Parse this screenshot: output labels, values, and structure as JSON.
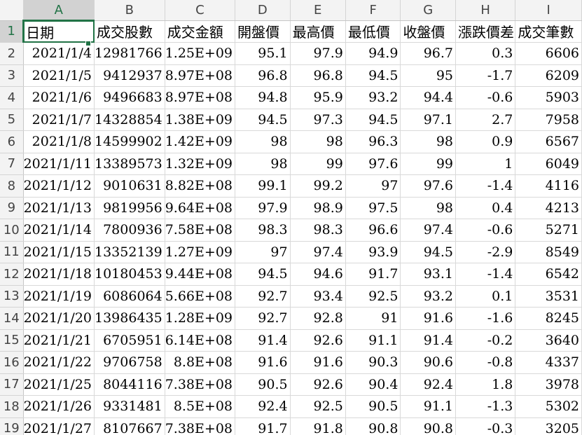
{
  "columns": [
    "A",
    "B",
    "C",
    "D",
    "E",
    "F",
    "G",
    "H",
    "I"
  ],
  "header_row": {
    "row_num": "1",
    "cells": [
      "日期",
      "成交股數",
      "成交金額",
      "開盤價",
      "最高價",
      "最低價",
      "收盤價",
      "漲跌價差",
      "成交筆數"
    ]
  },
  "rows": [
    {
      "row_num": "2",
      "cells": [
        "2021/1/4",
        "12981766",
        "1.25E+09",
        "95.1",
        "97.9",
        "94.9",
        "96.7",
        "0.3",
        "6606"
      ]
    },
    {
      "row_num": "3",
      "cells": [
        "2021/1/5",
        "9412937",
        "8.97E+08",
        "96.8",
        "96.8",
        "94.5",
        "95",
        "-1.7",
        "6209"
      ]
    },
    {
      "row_num": "4",
      "cells": [
        "2021/1/6",
        "9496683",
        "8.97E+08",
        "94.8",
        "95.9",
        "93.2",
        "94.4",
        "-0.6",
        "5903"
      ]
    },
    {
      "row_num": "5",
      "cells": [
        "2021/1/7",
        "14328854",
        "1.38E+09",
        "94.5",
        "97.3",
        "94.5",
        "97.1",
        "2.7",
        "7958"
      ]
    },
    {
      "row_num": "6",
      "cells": [
        "2021/1/8",
        "14599902",
        "1.42E+09",
        "98",
        "98",
        "96.3",
        "98",
        "0.9",
        "6567"
      ]
    },
    {
      "row_num": "7",
      "cells": [
        "2021/1/11",
        "13389573",
        "1.32E+09",
        "98",
        "99",
        "97.6",
        "99",
        "1",
        "6049"
      ]
    },
    {
      "row_num": "8",
      "cells": [
        "2021/1/12",
        "9010631",
        "8.82E+08",
        "99.1",
        "99.2",
        "97",
        "97.6",
        "-1.4",
        "4116"
      ]
    },
    {
      "row_num": "9",
      "cells": [
        "2021/1/13",
        "9819956",
        "9.64E+08",
        "97.9",
        "98.9",
        "97.5",
        "98",
        "0.4",
        "4213"
      ]
    },
    {
      "row_num": "10",
      "cells": [
        "2021/1/14",
        "7800936",
        "7.58E+08",
        "98.3",
        "98.3",
        "96.6",
        "97.4",
        "-0.6",
        "5271"
      ]
    },
    {
      "row_num": "11",
      "cells": [
        "2021/1/15",
        "13352139",
        "1.27E+09",
        "97",
        "97.4",
        "93.9",
        "94.5",
        "-2.9",
        "8549"
      ]
    },
    {
      "row_num": "12",
      "cells": [
        "2021/1/18",
        "10180453",
        "9.44E+08",
        "94.5",
        "94.6",
        "91.7",
        "93.1",
        "-1.4",
        "6542"
      ]
    },
    {
      "row_num": "13",
      "cells": [
        "2021/1/19",
        "6086064",
        "5.66E+08",
        "92.7",
        "93.4",
        "92.5",
        "93.2",
        "0.1",
        "3531"
      ]
    },
    {
      "row_num": "14",
      "cells": [
        "2021/1/20",
        "13986435",
        "1.28E+09",
        "92.7",
        "92.8",
        "91",
        "91.6",
        "-1.6",
        "8245"
      ]
    },
    {
      "row_num": "15",
      "cells": [
        "2021/1/21",
        "6705951",
        "6.14E+08",
        "91.4",
        "92.6",
        "91.1",
        "91.4",
        "-0.2",
        "3640"
      ]
    },
    {
      "row_num": "16",
      "cells": [
        "2021/1/22",
        "9706758",
        "8.8E+08",
        "91.6",
        "91.6",
        "90.3",
        "90.6",
        "-0.8",
        "4337"
      ]
    },
    {
      "row_num": "17",
      "cells": [
        "2021/1/25",
        "8044116",
        "7.38E+08",
        "90.5",
        "92.6",
        "90.4",
        "92.4",
        "1.8",
        "3978"
      ]
    },
    {
      "row_num": "18",
      "cells": [
        "2021/1/26",
        "9331481",
        "8.5E+08",
        "92.4",
        "92.5",
        "90.5",
        "91.1",
        "-1.3",
        "5302"
      ]
    },
    {
      "row_num": "19",
      "cells": [
        "2021/1/27",
        "8107667",
        "7.38E+08",
        "91.7",
        "91.8",
        "90.8",
        "90.8",
        "-0.3",
        "3205"
      ]
    }
  ],
  "selection": {
    "active_cell": "A1"
  },
  "colors": {
    "accent": "#217346",
    "header_bg": "#f3f3f3",
    "grid": "#d9d9d9"
  }
}
